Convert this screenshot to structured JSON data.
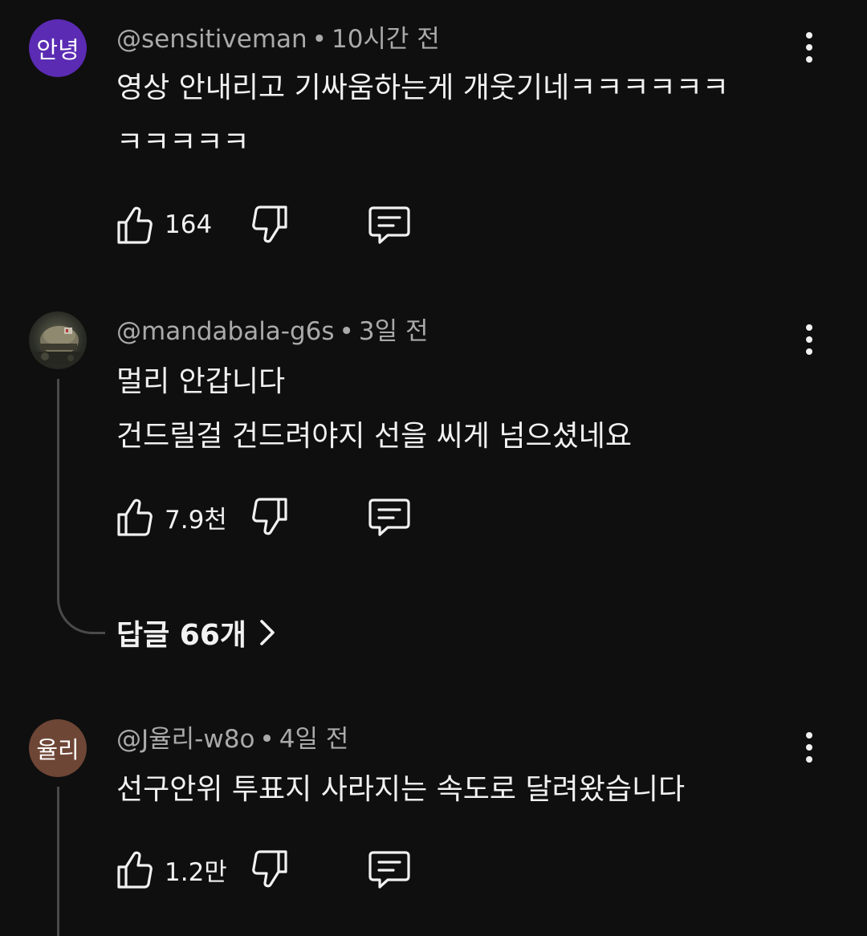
{
  "comments": [
    {
      "avatar_text": "안녕",
      "avatar_color": "#5b2bb4",
      "author": "@sensitiveman",
      "separator": "•",
      "time": "10시간 전",
      "text": "영상 안내리고 기싸움하는게 개웃기네ㅋㅋㅋㅋㅋㅋ\nㅋㅋㅋㅋㅋ",
      "likes": "164",
      "icons": [
        "thumbs-up-icon",
        "thumbs-down-icon",
        "reply-comment-icon",
        "more-vert-icon"
      ]
    },
    {
      "avatar_text": "",
      "avatar_image": "helmet-photo",
      "author": "@mandabala-g6s",
      "separator": "•",
      "time": "3일 전",
      "text": "멀리 안갑니다\n건드릴걸 건드려야지 선을 씨게 넘으셨네요",
      "likes": "7.9천",
      "replies_label": "답글 66개",
      "icons": [
        "thumbs-up-icon",
        "thumbs-down-icon",
        "reply-comment-icon",
        "more-vert-icon",
        "chevron-right-icon"
      ]
    },
    {
      "avatar_text": "율리",
      "avatar_color": "#6e4636",
      "author": "@J율리-w8o",
      "separator": "•",
      "time": "4일 전",
      "text": "선구안위 투표지 사라지는 속도로 달려왔습니다",
      "likes": "1.2만",
      "icons": [
        "thumbs-up-icon",
        "thumbs-down-icon",
        "reply-comment-icon",
        "more-vert-icon"
      ]
    }
  ],
  "colors": {
    "background": "#0f0f0f",
    "primary_text": "#f1f1f1",
    "secondary_text": "#aaaaaa",
    "thread_line": "#4a4a4a"
  }
}
